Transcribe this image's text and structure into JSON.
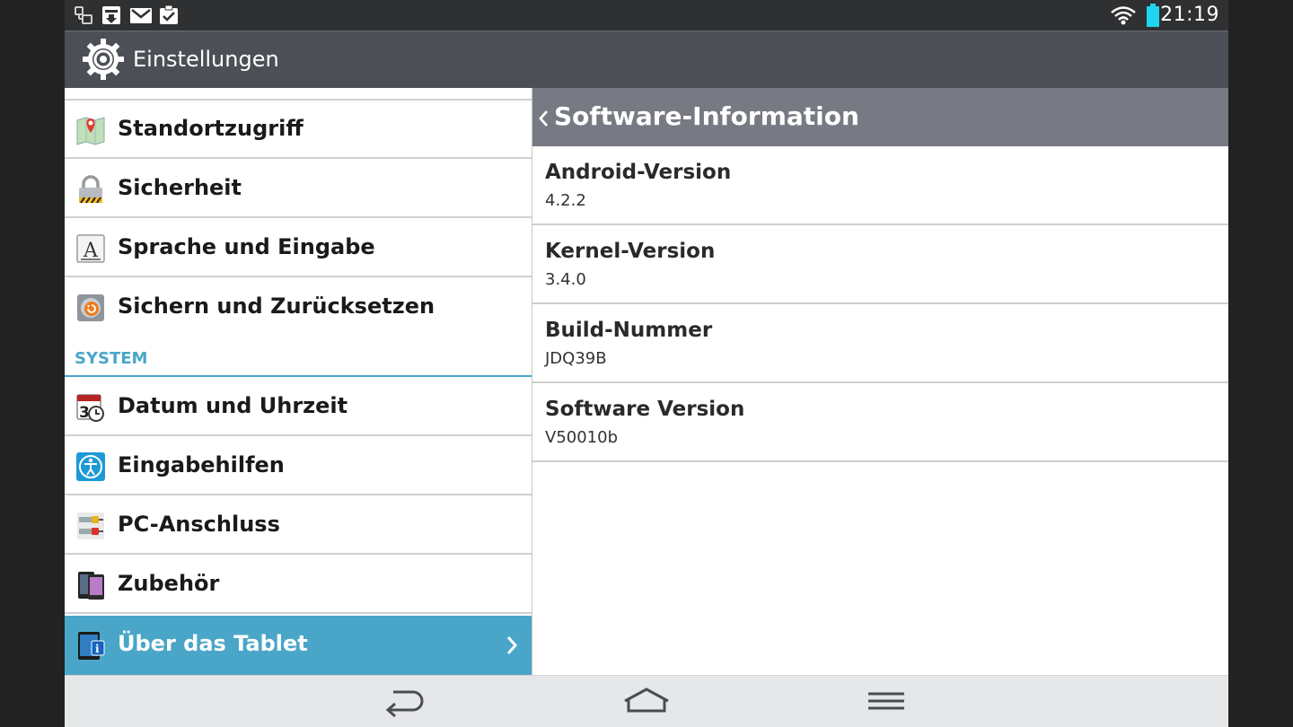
{
  "status_bar": {
    "time": "21:19",
    "icons": [
      "usb-debug-icon",
      "download-icon",
      "gmail-icon",
      "task-icon",
      "wifi-icon",
      "battery-icon"
    ],
    "battery_color": "#1fd6f0"
  },
  "action_bar": {
    "title": "Einstellungen",
    "icon": "gear-icon"
  },
  "left_menu": {
    "items_top": [
      {
        "label": "Standortzugriff",
        "icon": "map-pin-icon"
      },
      {
        "label": "Sicherheit",
        "icon": "lock-icon"
      },
      {
        "label": "Sprache und Eingabe",
        "icon": "keyboard-letter-icon"
      },
      {
        "label": "Sichern und Zurücksetzen",
        "icon": "backup-restore-icon"
      }
    ],
    "section_header": "SYSTEM",
    "items_system": [
      {
        "label": "Datum und Uhrzeit",
        "icon": "calendar-clock-icon"
      },
      {
        "label": "Eingabehilfen",
        "icon": "accessibility-icon"
      },
      {
        "label": "PC-Anschluss",
        "icon": "usb-cable-icon"
      },
      {
        "label": "Zubehör",
        "icon": "accessory-phone-icon"
      },
      {
        "label": "Über das Tablet",
        "icon": "tablet-info-icon",
        "selected": true
      }
    ],
    "accent_color": "#4aa6c8"
  },
  "detail": {
    "title": "Software-Information",
    "rows": [
      {
        "label": "Android-Version",
        "value": "4.2.2"
      },
      {
        "label": "Kernel-Version",
        "value": "3.4.0"
      },
      {
        "label": "Build-Nummer",
        "value": "JDQ39B"
      },
      {
        "label": "Software Version",
        "value": "V50010b"
      }
    ]
  },
  "nav_bar": {
    "buttons": [
      "back-icon",
      "home-icon",
      "menu-icon"
    ]
  }
}
